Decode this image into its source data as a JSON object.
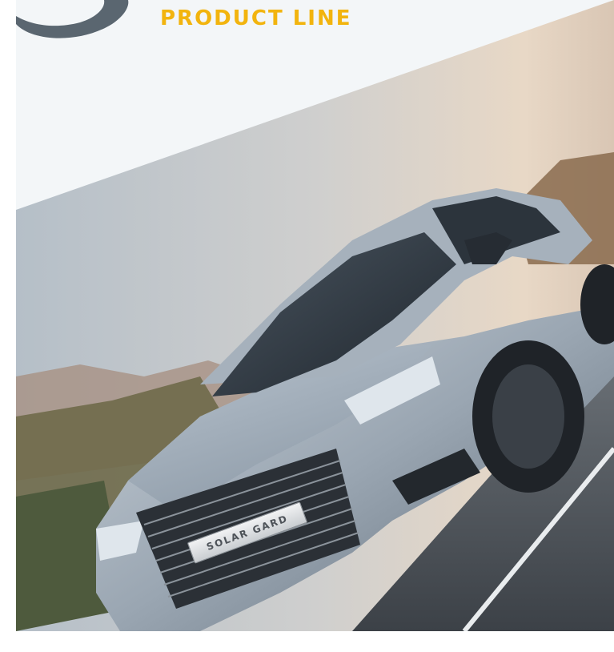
{
  "document": {
    "headline": "PRODUCT LINE",
    "badge_text": "SOLAR GARD"
  },
  "colors": {
    "headline": "#f2b40e",
    "logo_mark": "#5a6670",
    "background": "#f3f6f8"
  },
  "icons": {
    "logo": "brand-swirl-logo"
  }
}
